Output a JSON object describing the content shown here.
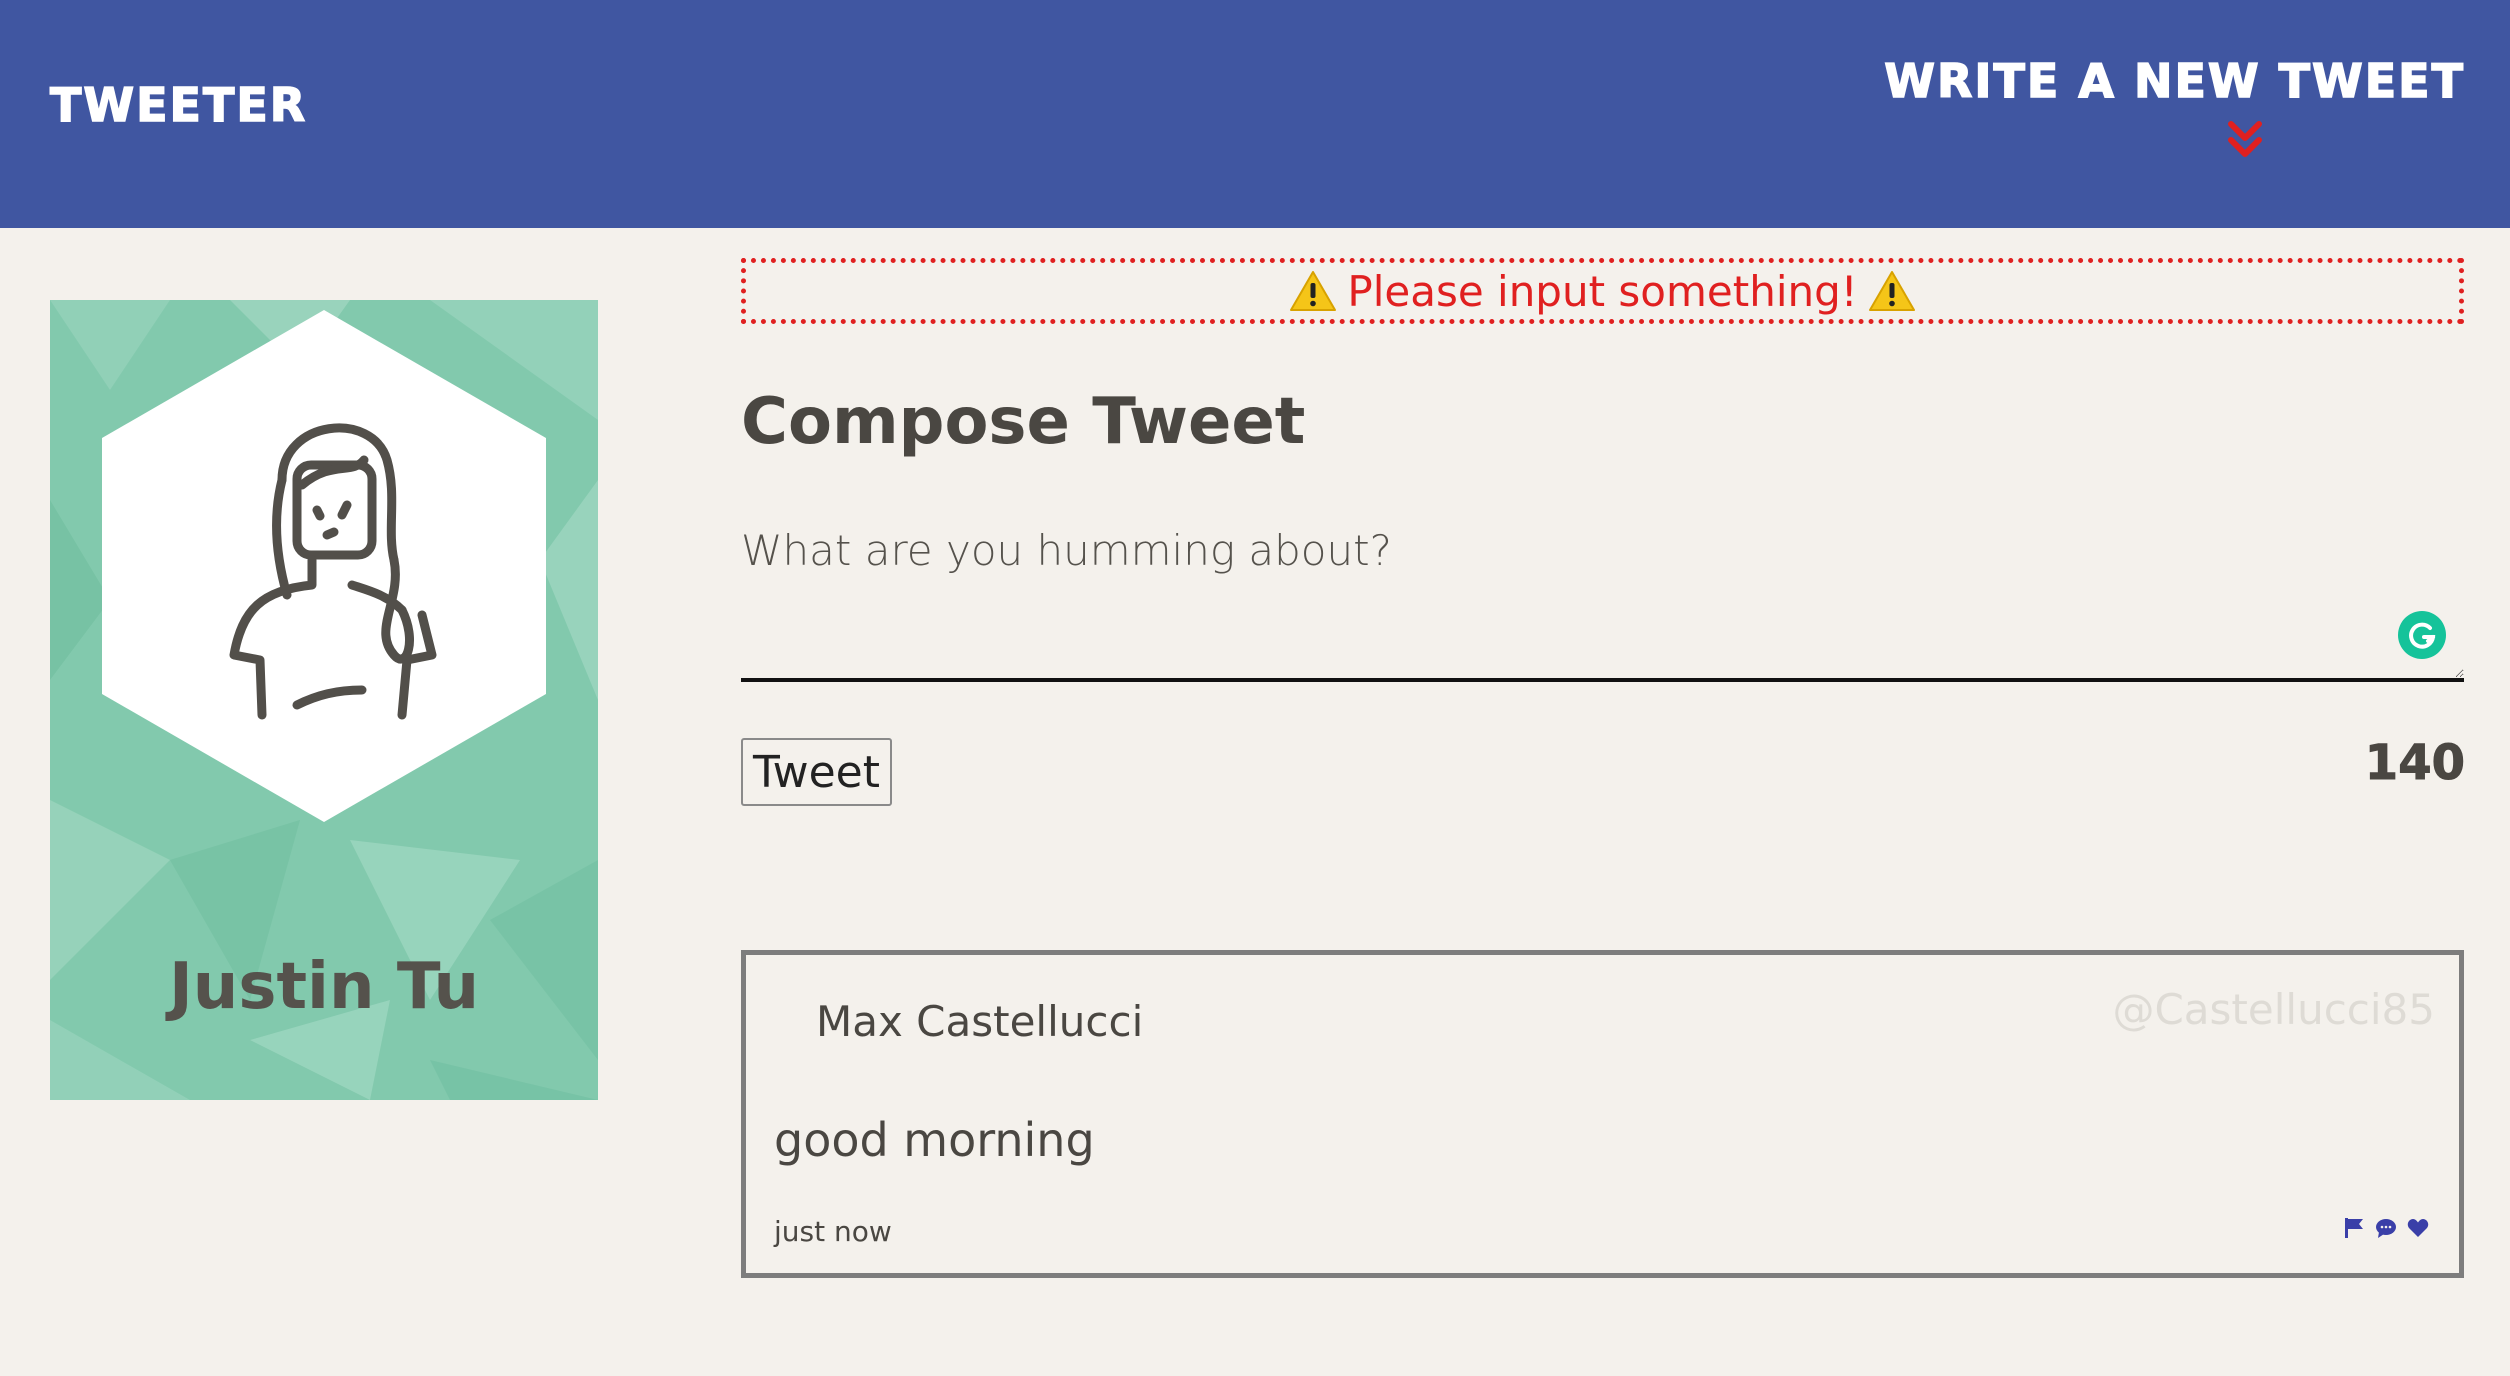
{
  "header": {
    "brand": "TWEETER",
    "compose_toggle_label": "WRITE A NEW TWEET",
    "toggle_icon": "double-chevron-down-icon",
    "background_color": "#4056a1",
    "accent_color": "#e02020"
  },
  "profile": {
    "name": "Justin Tu",
    "avatar_icon": "person-avatar-icon",
    "card_color": "#82c9ad"
  },
  "compose": {
    "error_message": "Please input something!",
    "error_icon": "warning-icon",
    "title": "Compose Tweet",
    "input_placeholder": "What are you humming about?",
    "input_value": "",
    "tweet_button_label": "Tweet",
    "char_counter": "140"
  },
  "tweets": [
    {
      "author": "Max Castellucci",
      "handle": "@Castellucci85",
      "body": "good morning",
      "timestamp": "just now",
      "action_icons": [
        "flag-icon",
        "comment-icon",
        "heart-icon"
      ]
    }
  ]
}
